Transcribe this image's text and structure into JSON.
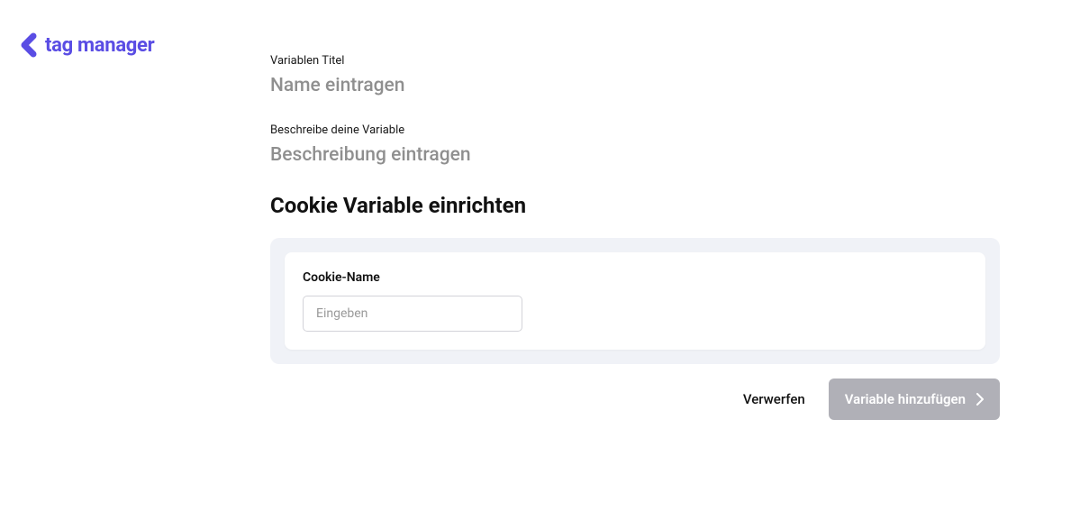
{
  "brand": {
    "name": "tag manager"
  },
  "form": {
    "title_label": "Variablen Titel",
    "title_placeholder": "Name eintragen",
    "desc_label": "Beschreibe deine Variable",
    "desc_placeholder": "Beschreibung eintragen",
    "section_title": "Cookie Variable einrichten",
    "cookie_name_label": "Cookie-Name",
    "cookie_name_placeholder": "Eingeben"
  },
  "actions": {
    "discard": "Verwerfen",
    "submit": "Variable hinzufügen"
  }
}
